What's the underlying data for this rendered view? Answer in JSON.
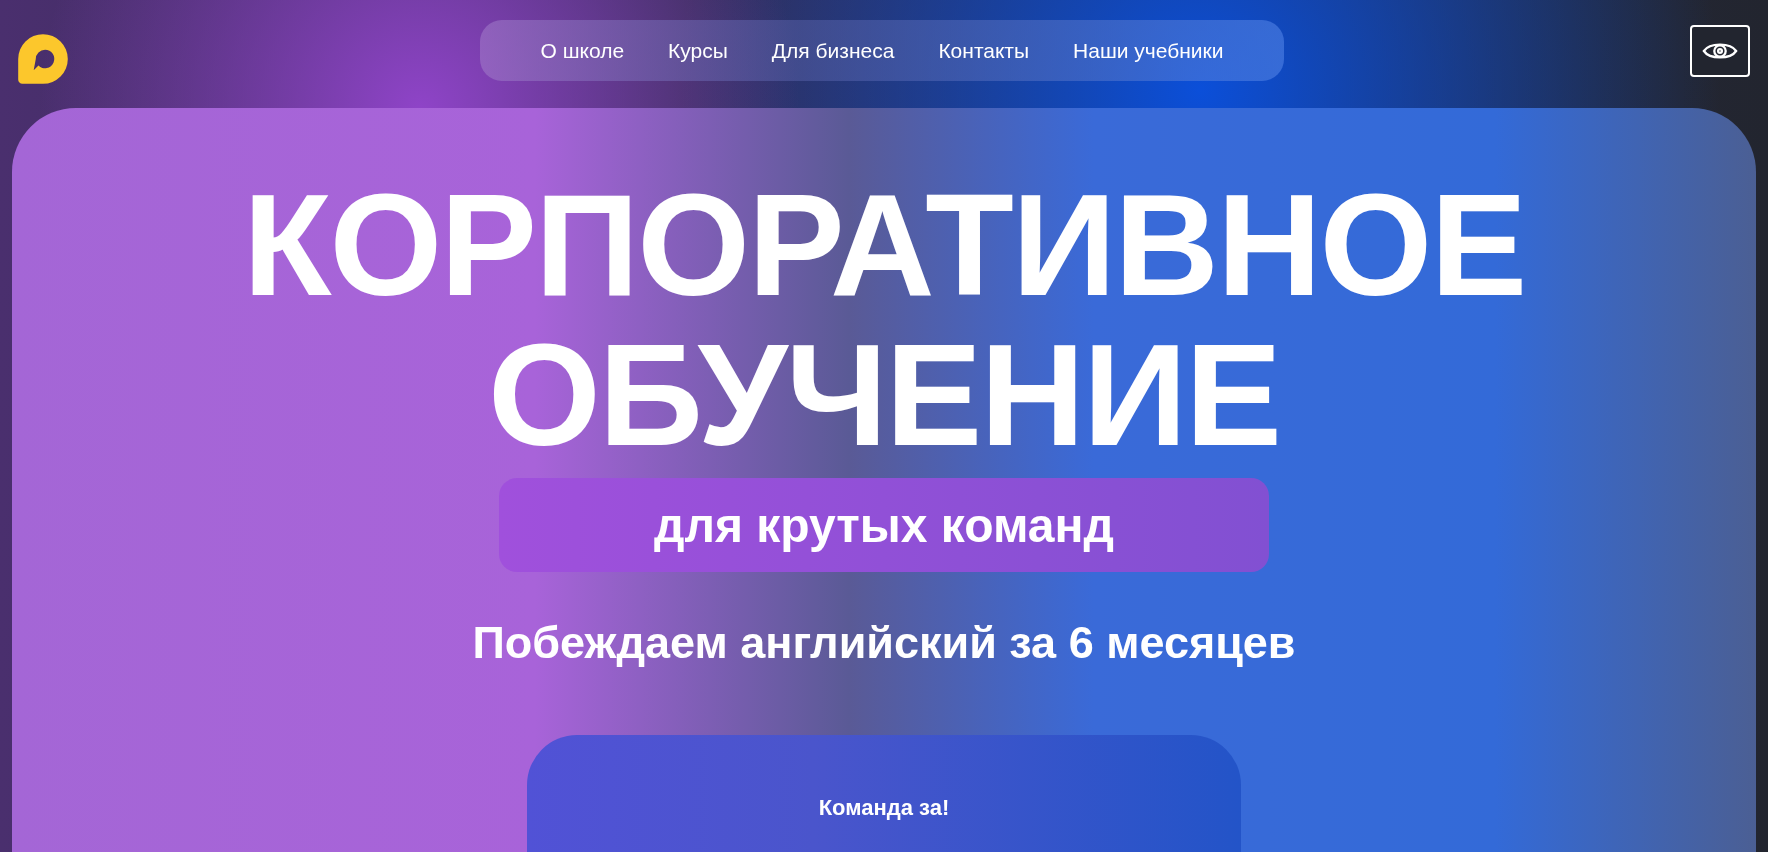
{
  "nav": [
    {
      "label": "О школе"
    },
    {
      "label": "Курсы"
    },
    {
      "label": "Для бизнеса"
    },
    {
      "label": "Контакты"
    },
    {
      "label": "Наши учебники"
    }
  ],
  "hero": {
    "title_lines": [
      "КОРПОРАТИВНОЕ",
      "ОБУЧЕНИЕ"
    ],
    "tagline": "для крутых команд",
    "subtitle": "Побеждаем английский за 6 месяцев"
  },
  "card": {
    "title": "Команда за!"
  }
}
